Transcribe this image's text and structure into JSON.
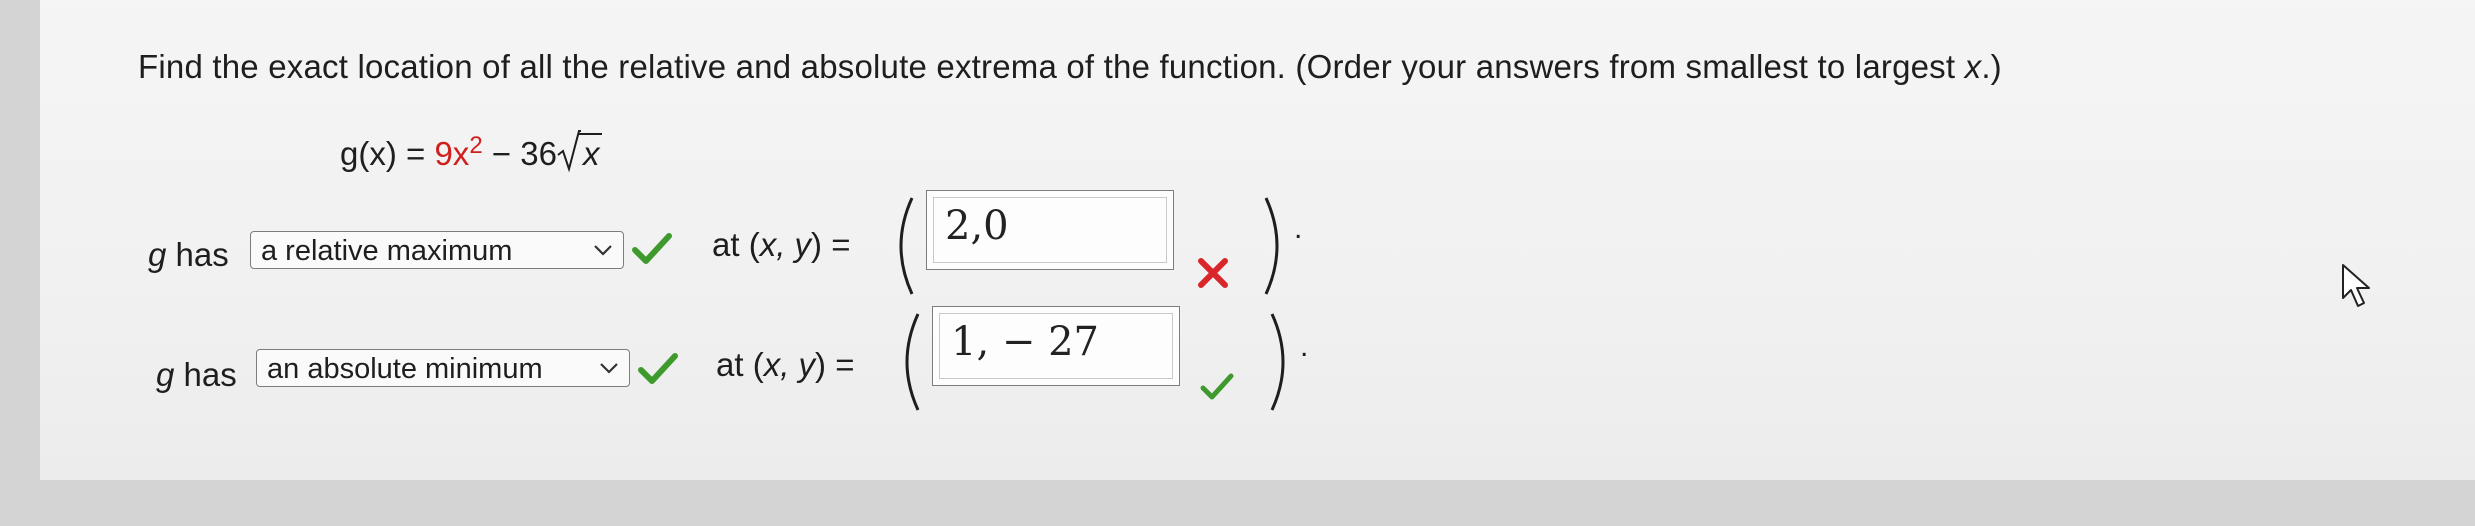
{
  "question": {
    "prompt_text": "Find the exact location of all the relative and absolute extrema of the function. (Order your answers from smallest to largest ",
    "prompt_var": "x",
    "prompt_end": ".)"
  },
  "formula": {
    "lhs": "g(x) = ",
    "term1": "9x",
    "term1_exp": "2",
    "minus": " − 36",
    "radicand": "x"
  },
  "rows": [
    {
      "g_label": "g",
      "has_label": " has",
      "selected_option": "a relative maximum",
      "select_status": "correct",
      "at_label": "at (",
      "xy": "x, y",
      "equals": ") =",
      "answer_value": "2,0",
      "answer_status": "incorrect",
      "end_punct": "."
    },
    {
      "g_label": "g",
      "has_label": " has",
      "selected_option": "an absolute minimum",
      "select_status": "correct",
      "at_label": "at (",
      "xy": "x, y",
      "equals": ") =",
      "answer_value": "1, − 27",
      "answer_status": "correct",
      "end_punct": "."
    }
  ],
  "icons": {
    "check_color": "#3f9a2e",
    "cross_color": "#d8262b",
    "dropdown": "chevron-down-icon",
    "cursor": "mouse-pointer-icon"
  }
}
